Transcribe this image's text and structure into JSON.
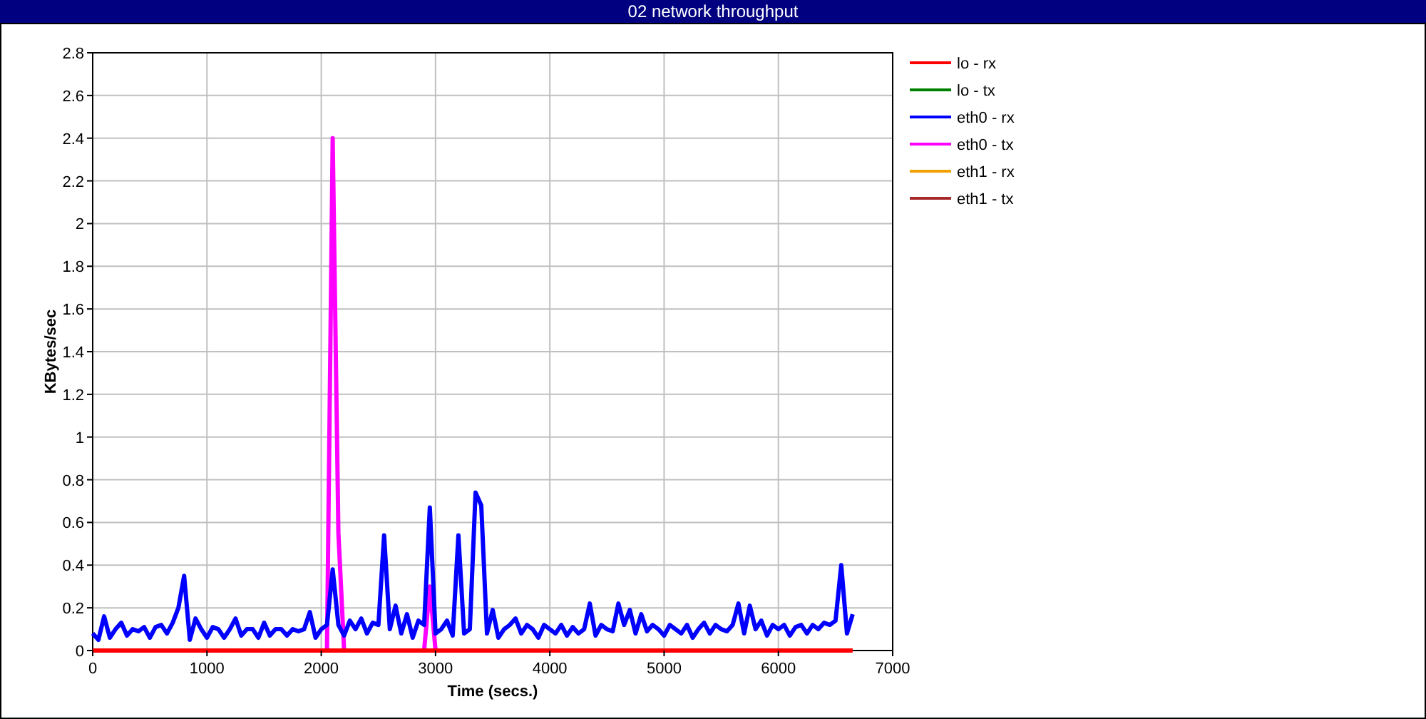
{
  "window": {
    "title": "02 network throughput"
  },
  "chart": {
    "chart_data": {
      "type": "line",
      "xlabel": "Time (secs.)",
      "ylabel": "KBytes/sec",
      "grid": true,
      "legend": true,
      "xlim": [
        0,
        7000
      ],
      "ylim": [
        0,
        2.8
      ],
      "xticks": [
        0,
        1000,
        2000,
        3000,
        4000,
        5000,
        6000,
        7000
      ],
      "yticks": [
        0,
        0.2,
        0.4,
        0.6,
        0.8,
        1,
        1.2,
        1.4,
        1.6,
        1.8,
        2,
        2.2,
        2.4,
        2.6,
        2.8
      ],
      "x": [
        0,
        50,
        100,
        150,
        200,
        250,
        300,
        350,
        400,
        450,
        500,
        550,
        600,
        650,
        700,
        750,
        800,
        850,
        900,
        950,
        1000,
        1050,
        1100,
        1150,
        1200,
        1250,
        1300,
        1350,
        1400,
        1450,
        1500,
        1550,
        1600,
        1650,
        1700,
        1750,
        1800,
        1850,
        1900,
        1950,
        2000,
        2050,
        2100,
        2150,
        2200,
        2250,
        2300,
        2350,
        2400,
        2450,
        2500,
        2550,
        2600,
        2650,
        2700,
        2750,
        2800,
        2850,
        2900,
        2950,
        3000,
        3050,
        3100,
        3150,
        3200,
        3250,
        3300,
        3350,
        3400,
        3450,
        3500,
        3550,
        3600,
        3650,
        3700,
        3750,
        3800,
        3850,
        3900,
        3950,
        4000,
        4050,
        4100,
        4150,
        4200,
        4250,
        4300,
        4350,
        4400,
        4450,
        4500,
        4550,
        4600,
        4650,
        4700,
        4750,
        4800,
        4850,
        4900,
        4950,
        5000,
        5050,
        5100,
        5150,
        5200,
        5250,
        5300,
        5350,
        5400,
        5450,
        5500,
        5550,
        5600,
        5650,
        5700,
        5750,
        5800,
        5850,
        5900,
        5950,
        6000,
        6050,
        6100,
        6150,
        6200,
        6250,
        6300,
        6350,
        6400,
        6450,
        6500,
        6550,
        6600,
        6650
      ],
      "series": [
        {
          "name": "lo - rx",
          "color": "#ff0000",
          "values": [
            0,
            0,
            0,
            0,
            0,
            0,
            0,
            0,
            0,
            0,
            0,
            0,
            0,
            0,
            0,
            0,
            0,
            0,
            0,
            0,
            0,
            0,
            0,
            0,
            0,
            0,
            0,
            0,
            0,
            0,
            0,
            0,
            0,
            0,
            0,
            0,
            0,
            0,
            0,
            0,
            0,
            0,
            0,
            0,
            0,
            0,
            0,
            0,
            0,
            0,
            0,
            0,
            0,
            0,
            0,
            0,
            0,
            0,
            0,
            0,
            0,
            0,
            0,
            0,
            0,
            0,
            0,
            0,
            0,
            0,
            0,
            0,
            0,
            0,
            0,
            0,
            0,
            0,
            0,
            0,
            0,
            0,
            0,
            0,
            0,
            0,
            0,
            0,
            0,
            0,
            0,
            0,
            0,
            0,
            0,
            0,
            0,
            0,
            0,
            0,
            0,
            0,
            0,
            0,
            0,
            0,
            0,
            0,
            0,
            0,
            0,
            0,
            0,
            0,
            0,
            0,
            0,
            0,
            0,
            0,
            0,
            0,
            0,
            0,
            0,
            0,
            0,
            0,
            0,
            0,
            0,
            0,
            0,
            0
          ]
        },
        {
          "name": "lo - tx",
          "color": "#008000",
          "values": [
            null,
            null,
            null,
            null,
            null,
            null,
            null,
            null,
            null,
            null,
            null,
            null,
            null,
            null,
            null,
            null,
            null,
            null,
            null,
            null,
            null,
            null,
            null,
            null,
            null,
            null,
            null,
            null,
            null,
            null,
            null,
            null,
            null,
            null,
            null,
            null,
            null,
            null,
            null,
            null,
            null,
            null,
            null,
            null,
            null,
            null,
            null,
            null,
            null,
            null,
            null,
            null,
            null,
            null,
            null,
            null,
            null,
            null,
            null,
            null,
            null,
            null,
            null,
            null,
            null,
            null,
            null,
            null,
            null,
            null,
            null,
            null,
            null,
            null,
            null,
            null,
            null,
            null,
            null,
            null,
            null,
            null,
            null,
            null,
            null,
            null,
            null,
            null,
            null,
            null,
            null,
            null,
            null,
            null,
            null,
            null,
            null,
            null,
            null,
            null,
            null,
            null,
            null,
            null,
            null,
            null,
            null,
            null,
            null,
            null,
            null,
            null,
            null,
            null,
            null,
            null,
            null,
            null,
            null,
            null,
            null,
            null,
            null,
            null,
            null,
            null,
            null,
            null,
            null,
            null,
            null,
            null,
            null,
            null
          ]
        },
        {
          "name": "eth0 - rx",
          "color": "#0000ff",
          "values": [
            0.08,
            0.05,
            0.16,
            0.06,
            0.1,
            0.13,
            0.07,
            0.1,
            0.09,
            0.11,
            0.06,
            0.11,
            0.12,
            0.08,
            0.13,
            0.2,
            0.35,
            0.05,
            0.15,
            0.1,
            0.06,
            0.11,
            0.1,
            0.06,
            0.1,
            0.15,
            0.07,
            0.1,
            0.1,
            0.06,
            0.13,
            0.07,
            0.1,
            0.1,
            0.07,
            0.1,
            0.09,
            0.1,
            0.18,
            0.06,
            0.1,
            0.12,
            0.38,
            0.12,
            0.07,
            0.14,
            0.1,
            0.15,
            0.08,
            0.13,
            0.12,
            0.54,
            0.1,
            0.21,
            0.08,
            0.17,
            0.06,
            0.14,
            0.12,
            0.67,
            0.08,
            0.1,
            0.14,
            0.07,
            0.54,
            0.08,
            0.1,
            0.74,
            0.68,
            0.08,
            0.19,
            0.06,
            0.1,
            0.12,
            0.15,
            0.08,
            0.12,
            0.1,
            0.06,
            0.12,
            0.1,
            0.08,
            0.12,
            0.07,
            0.11,
            0.08,
            0.1,
            0.22,
            0.07,
            0.12,
            0.1,
            0.09,
            0.22,
            0.12,
            0.19,
            0.08,
            0.17,
            0.09,
            0.12,
            0.1,
            0.07,
            0.12,
            0.1,
            0.08,
            0.12,
            0.06,
            0.1,
            0.13,
            0.08,
            0.12,
            0.1,
            0.09,
            0.12,
            0.22,
            0.08,
            0.21,
            0.1,
            0.14,
            0.07,
            0.12,
            0.1,
            0.12,
            0.07,
            0.11,
            0.12,
            0.08,
            0.12,
            0.1,
            0.13,
            0.12,
            0.14,
            0.4,
            0.08,
            0.17
          ]
        },
        {
          "name": "eth0 - tx",
          "color": "#ff00ff",
          "values": [
            null,
            null,
            null,
            null,
            null,
            null,
            null,
            null,
            null,
            null,
            null,
            null,
            null,
            null,
            null,
            null,
            null,
            null,
            null,
            null,
            null,
            null,
            null,
            null,
            null,
            null,
            null,
            null,
            null,
            null,
            null,
            null,
            null,
            null,
            null,
            null,
            null,
            null,
            null,
            null,
            null,
            0,
            2.4,
            0.55,
            0,
            null,
            null,
            null,
            null,
            null,
            null,
            null,
            null,
            null,
            null,
            null,
            null,
            null,
            0,
            0.3,
            0,
            null,
            null,
            null,
            null,
            null,
            null,
            null,
            null,
            null,
            null,
            null,
            null,
            null,
            null,
            null,
            null,
            null,
            null,
            null,
            null,
            null,
            null,
            null,
            null,
            null,
            null,
            null,
            null,
            null,
            null,
            null,
            null,
            null,
            null,
            null,
            null,
            null,
            null,
            null,
            null,
            null,
            null,
            null,
            null,
            null,
            null,
            null,
            null,
            null,
            null,
            null,
            null,
            null,
            null,
            null,
            null,
            null,
            null,
            null,
            null,
            null,
            null,
            null,
            null,
            null,
            null,
            null,
            null,
            null,
            null,
            null,
            null,
            null
          ]
        },
        {
          "name": "eth1 - rx",
          "color": "#f0a000",
          "values": [
            null,
            null,
            null,
            null,
            null,
            null,
            null,
            null,
            null,
            null,
            null,
            null,
            null,
            null,
            null,
            null,
            null,
            null,
            null,
            null,
            null,
            null,
            null,
            null,
            null,
            null,
            null,
            null,
            null,
            null,
            null,
            null,
            null,
            null,
            null,
            null,
            null,
            null,
            null,
            null,
            null,
            null,
            null,
            null,
            null,
            null,
            null,
            null,
            null,
            null,
            null,
            null,
            null,
            null,
            null,
            null,
            null,
            null,
            null,
            null,
            null,
            null,
            null,
            null,
            null,
            null,
            null,
            null,
            null,
            null,
            null,
            null,
            null,
            null,
            null,
            null,
            null,
            null,
            null,
            null,
            null,
            null,
            null,
            null,
            null,
            null,
            null,
            null,
            null,
            null,
            null,
            null,
            null,
            null,
            null,
            null,
            null,
            null,
            null,
            null,
            null,
            null,
            null,
            null,
            null,
            null,
            null,
            null,
            null,
            null,
            null,
            null,
            null,
            null,
            null,
            null,
            null,
            null,
            null,
            null,
            null,
            null,
            null,
            null,
            null,
            null,
            null,
            null,
            null,
            null,
            null,
            null,
            null,
            null
          ]
        },
        {
          "name": "eth1 - tx",
          "color": "#a52a2a",
          "values": [
            null,
            null,
            null,
            null,
            null,
            null,
            null,
            null,
            null,
            null,
            null,
            null,
            null,
            null,
            null,
            null,
            null,
            null,
            null,
            null,
            null,
            null,
            null,
            null,
            null,
            null,
            null,
            null,
            null,
            null,
            null,
            null,
            null,
            null,
            null,
            null,
            null,
            null,
            null,
            null,
            null,
            null,
            null,
            null,
            null,
            null,
            null,
            null,
            null,
            null,
            null,
            null,
            null,
            null,
            null,
            null,
            null,
            null,
            null,
            null,
            null,
            null,
            null,
            null,
            null,
            null,
            null,
            null,
            null,
            null,
            null,
            null,
            null,
            null,
            null,
            null,
            null,
            null,
            null,
            null,
            null,
            null,
            null,
            null,
            null,
            null,
            null,
            null,
            null,
            null,
            null,
            null,
            null,
            null,
            null,
            null,
            null,
            null,
            null,
            null,
            null,
            null,
            null,
            null,
            null,
            null,
            null,
            null,
            null,
            null,
            null,
            null,
            null,
            null,
            null,
            null,
            null,
            null,
            null,
            null,
            null,
            null,
            null,
            null,
            null,
            null,
            null,
            null,
            null,
            null,
            null,
            null,
            null,
            null
          ]
        }
      ]
    }
  }
}
